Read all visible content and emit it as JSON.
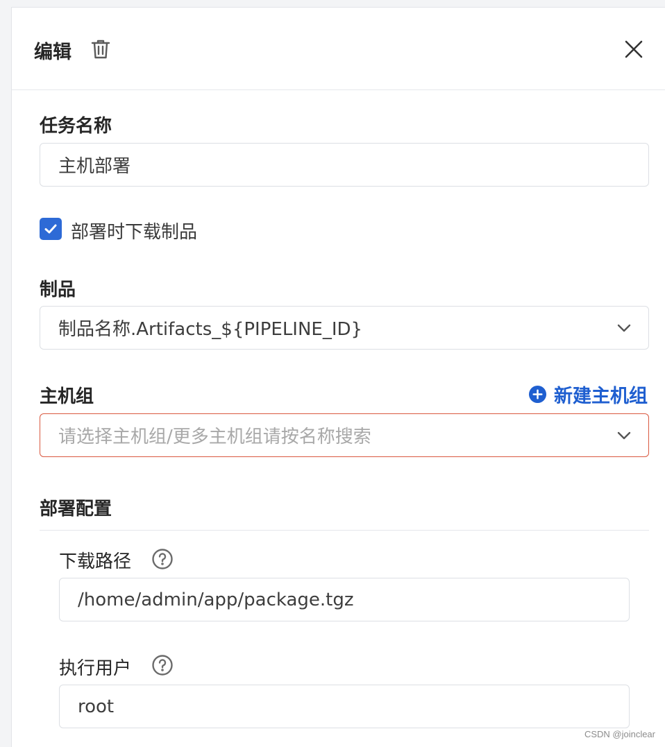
{
  "header": {
    "title": "编辑"
  },
  "task_name": {
    "label": "任务名称",
    "value": "主机部署"
  },
  "download_artifact": {
    "label": "部署时下载制品",
    "checked": true
  },
  "artifact": {
    "label": "制品",
    "value": "制品名称.Artifacts_${PIPELINE_ID}"
  },
  "host_group": {
    "label": "主机组",
    "placeholder": "请选择主机组/更多主机组请按名称搜索",
    "new_button": "新建主机组"
  },
  "deploy_config": {
    "label": "部署配置",
    "download_path": {
      "label": "下载路径",
      "value": "/home/admin/app/package.tgz"
    },
    "exec_user": {
      "label": "执行用户",
      "value": "root"
    }
  },
  "watermark": "CSDN @joinclear",
  "colors": {
    "accent": "#2d6ad6",
    "link": "#1f5fd0",
    "error_border": "#d9583f"
  }
}
